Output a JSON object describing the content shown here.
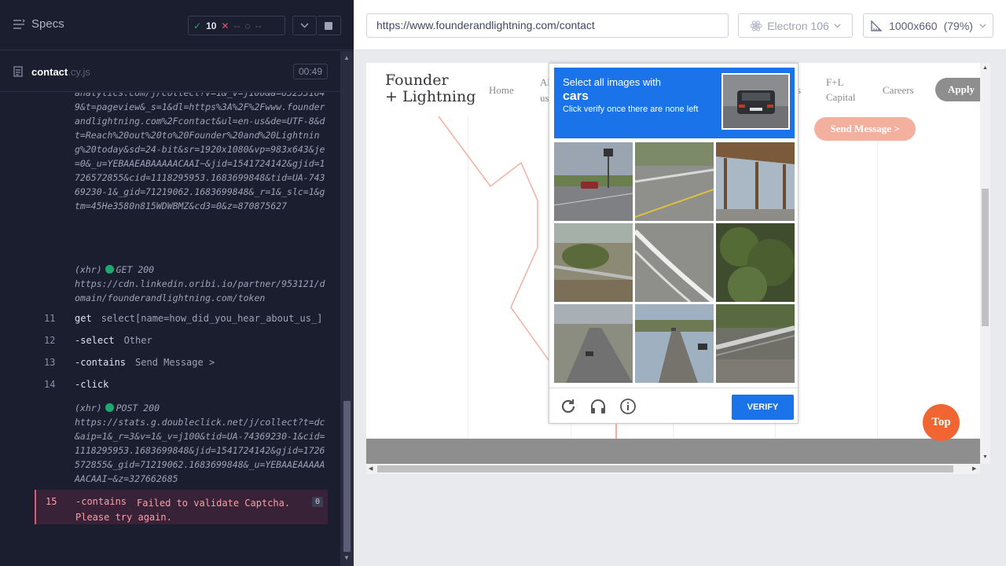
{
  "reporter": {
    "specs_label": "Specs",
    "stats": {
      "passed": "10",
      "failed": "--",
      "pending": "--"
    },
    "spec_file": {
      "name": "contact",
      "ext": ".cy.js",
      "duration": "00:49"
    }
  },
  "log": {
    "xhr1_tail": "analytics.com/j/collect?v=1&_v=j100&a=652531649&t=pageview&_s=1&dl=https%3A%2F%2Fwww.founderandlightning.com%2Fcontact&ul=en-us&de=UTF-8&dt=Reach%20out%20to%20Founder%20and%20Lightning%20today&sd=24-bit&sr=1920x1080&vp=983x643&je=0&_u=YEBAAEABAAAAACAAI~&jid=1541724142&gjid=1726572855&cid=1118295953.1683699848&tid=UA-74369230-1&_gid=71219062.1683699848&_r=1&_slc=1&gtm=45He3580n815WDWBMZ&cd3=0&z=870875627",
    "xhr2": {
      "tag": "(xhr)",
      "method": "GET 200",
      "url": "https://cdn.linkedin.oribi.io/partner/953121/domain/founderandlightning.com/token"
    },
    "cmd11": {
      "num": "11",
      "name": "get",
      "arg": "select[name=how_did_you_hear_about_us_]"
    },
    "cmd12": {
      "num": "12",
      "name": "-select",
      "arg": "Other"
    },
    "cmd13": {
      "num": "13",
      "name": "-contains",
      "arg": "Send Message >"
    },
    "cmd14": {
      "num": "14",
      "name": "-click",
      "arg": ""
    },
    "xhr3": {
      "tag": "(xhr)",
      "method": "POST 200",
      "url": "https://stats.g.doubleclick.net/j/collect?t=dc&aip=1&_r=3&v=1&_v=j100&tid=UA-74369230-1&cid=1118295953.1683699848&jid=1541724142&gjid=1726572855&_gid=71219062.1683699848&_u=YEBAAEAAAAAAACAAI~&z=327662685"
    },
    "cmd15": {
      "num": "15",
      "name": "-contains",
      "arg": "Failed to validate Captcha. Please try again.",
      "badge": "0"
    }
  },
  "aut": {
    "url": "https://www.founderandlightning.com/contact",
    "browser": "Electron 106",
    "viewport": "1000x660",
    "scale": "(79%)"
  },
  "site": {
    "logo_line1": "Founder",
    "logo_line2": "+ Lightning",
    "nav": {
      "home": "Home",
      "about_fragment1": "Al",
      "about_fragment2": "us",
      "fragment_s": "s",
      "capital_line1": "F+L",
      "capital_line2": "Capital",
      "careers": "Careers"
    },
    "apply": "Apply",
    "send_message": "Send Message >",
    "top": "Top"
  },
  "captcha": {
    "line1": "Select all images with",
    "target": "cars",
    "line3": "Click verify once there are none left",
    "verify": "VERIFY"
  },
  "colors": {
    "accent": "#1a73e8",
    "pass": "#1fa971",
    "fail": "#e45770",
    "brand_orange": "#f06532"
  }
}
